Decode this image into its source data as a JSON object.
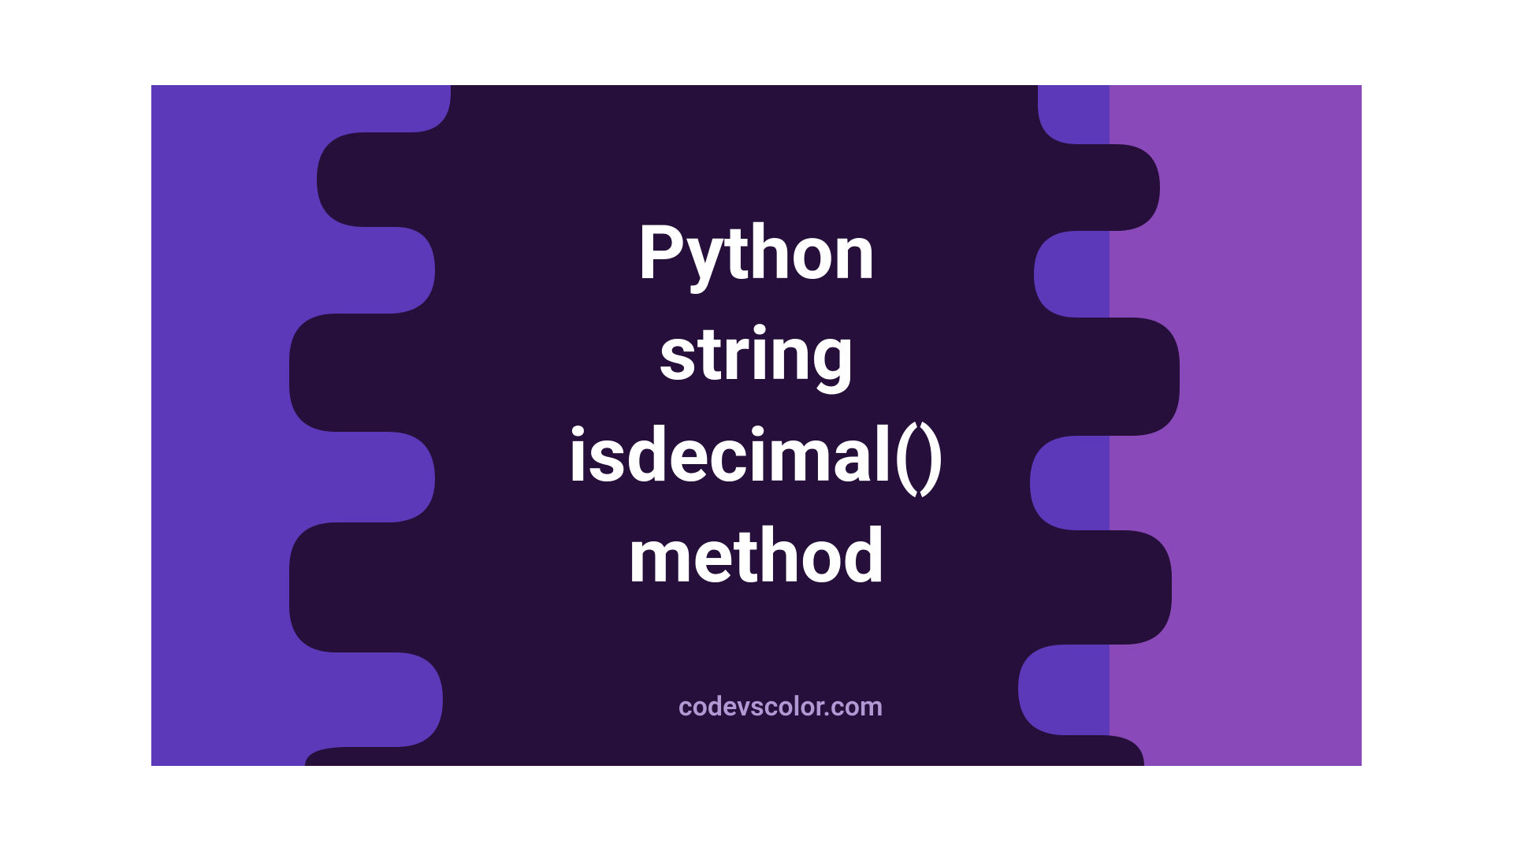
{
  "banner": {
    "title": "Python\nstring\nisdecimal()\nmethod",
    "watermark": "codevscolor.com"
  },
  "colors": {
    "left_bg": "#5b39b8",
    "right_bg": "#8a49b8",
    "blob": "#260f3a",
    "text": "#ffffff",
    "watermark": "#b19ad4"
  }
}
